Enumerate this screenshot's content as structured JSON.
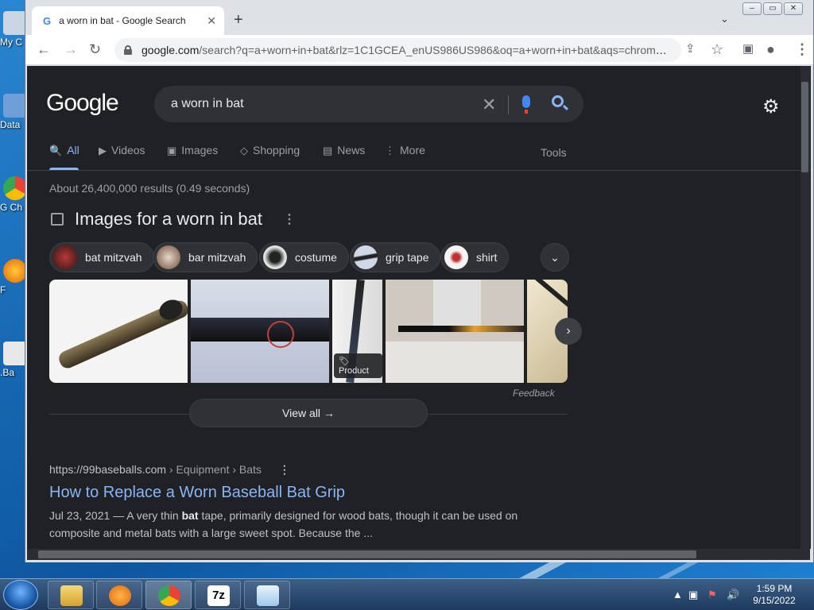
{
  "desktop": {
    "icons": [
      {
        "label": "My C"
      },
      {
        "label": "Data"
      },
      {
        "label": "G Ch"
      },
      {
        "label": "F"
      },
      {
        "label": ".Ba"
      }
    ]
  },
  "browser": {
    "tab_title": "a worn in bat - Google Search",
    "tab_favicon": "G",
    "tab_close": "✕",
    "new_tab": "+",
    "url_host": "google.com",
    "url_path": "/search?q=a+worn+in+bat&rlz=1C1GCEA_enUS986US986&oq=a+worn+in+bat&aqs=chrome...."
  },
  "google": {
    "logo": "Google",
    "query": "a worn in bat",
    "tabs": [
      {
        "label": "All",
        "icon": "🔍"
      },
      {
        "label": "Videos",
        "icon": "▶"
      },
      {
        "label": "Images",
        "icon": "▣"
      },
      {
        "label": "Shopping",
        "icon": "◇"
      },
      {
        "label": "News",
        "icon": "▤"
      },
      {
        "label": "More",
        "icon": "⋮"
      }
    ],
    "tools": "Tools",
    "stats": "About 26,400,000 results (0.49 seconds)",
    "images_heading": "Images for a worn in bat",
    "chips": [
      {
        "label": "bat mitzvah"
      },
      {
        "label": "bar mitzvah"
      },
      {
        "label": "costume"
      },
      {
        "label": "grip tape"
      },
      {
        "label": "shirt"
      }
    ],
    "product_badge": "Product",
    "feedback": "Feedback",
    "view_all": "View all",
    "result": {
      "site": "https://99baseballs.com",
      "breadcrumb": "› Equipment › Bats",
      "title": "How to Replace a Worn Baseball Bat Grip",
      "date": "Jul 23, 2021",
      "snippet_pre": " — A very thin ",
      "snippet_bold": "bat",
      "snippet_post": " tape, primarily designed for wood bats, though it can be used on composite and metal bats with a large sweet spot. Because the ..."
    }
  },
  "taskbar": {
    "time": "1:59 PM",
    "date": "9/15/2022",
    "app_7z": "7z"
  },
  "colors": {
    "accent": "#8ab4f8",
    "page_bg": "#202124",
    "surface": "#303134"
  }
}
